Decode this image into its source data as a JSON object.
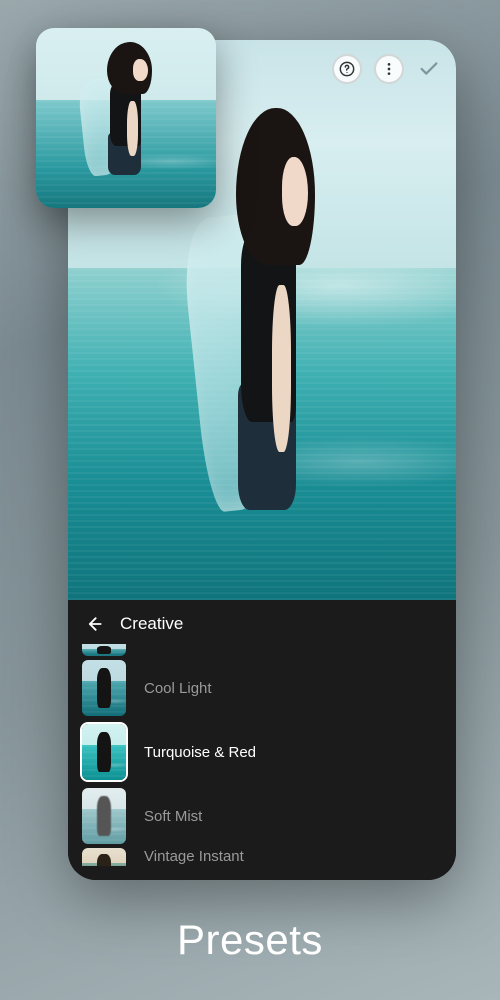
{
  "caption": "Presets",
  "toolbar": {
    "help_icon": "help-icon",
    "more_icon": "more-icon",
    "confirm_icon": "check-icon"
  },
  "panel": {
    "title": "Creative",
    "back_icon": "arrow-left-icon"
  },
  "presets": [
    {
      "label": "Cool Light",
      "selected": false
    },
    {
      "label": "Turquoise & Red",
      "selected": true
    },
    {
      "label": "Soft Mist",
      "selected": false
    },
    {
      "label": "Vintage Instant",
      "selected": false
    }
  ]
}
